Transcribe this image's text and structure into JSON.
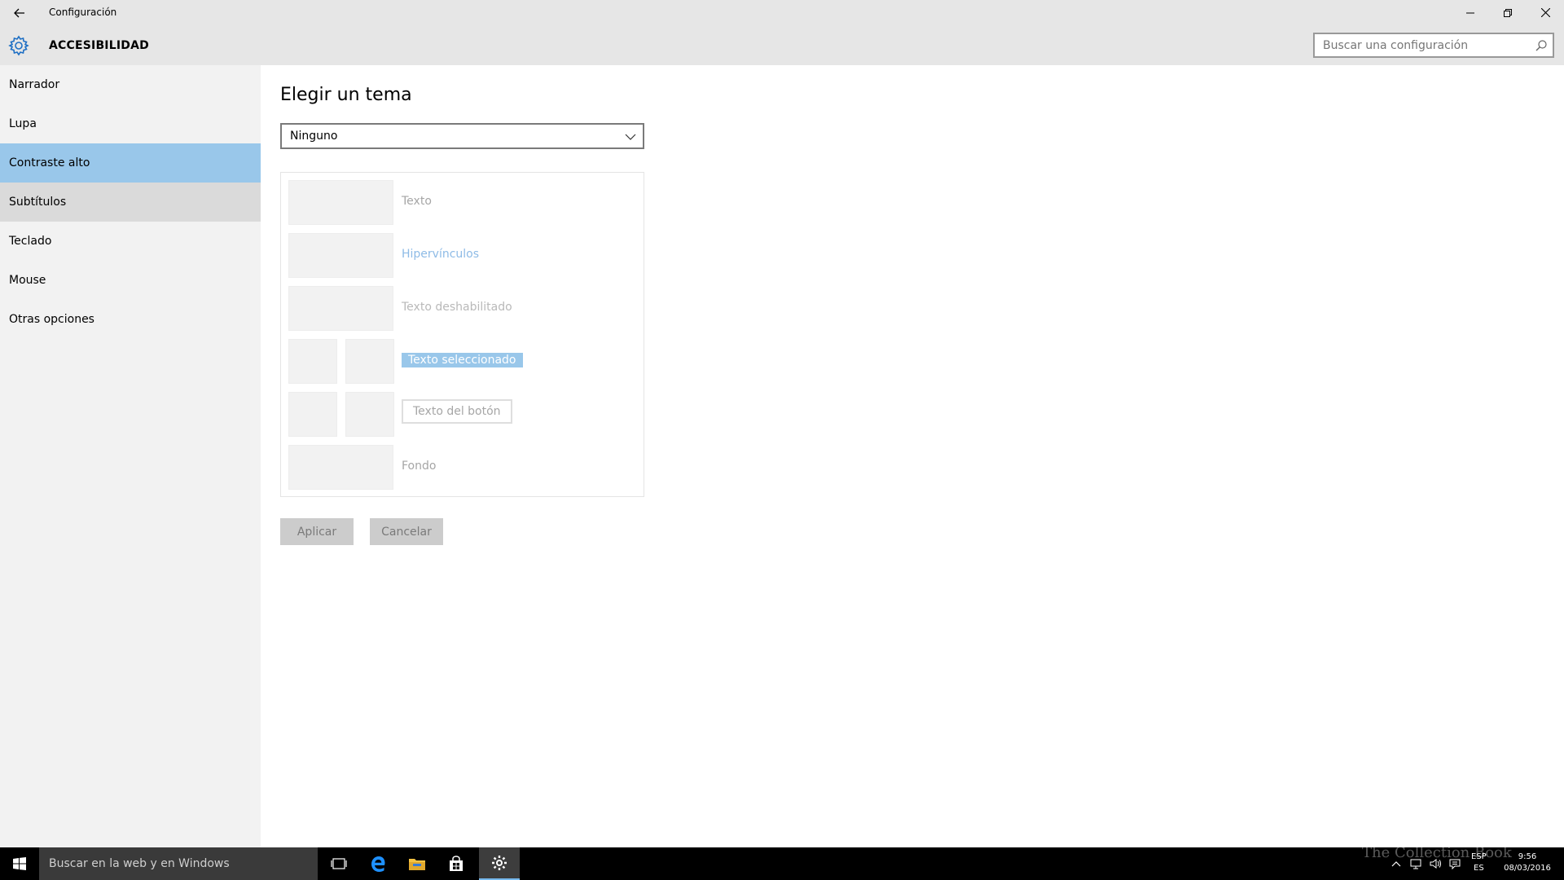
{
  "window": {
    "title": "Configuración"
  },
  "header": {
    "section_title": "ACCESIBILIDAD",
    "search_placeholder": "Buscar una configuración"
  },
  "sidebar": {
    "items": [
      {
        "label": "Narrador"
      },
      {
        "label": "Lupa"
      },
      {
        "label": "Contraste alto",
        "selected": true
      },
      {
        "label": "Subtítulos"
      },
      {
        "label": "Teclado"
      },
      {
        "label": "Mouse"
      },
      {
        "label": "Otras opciones"
      }
    ]
  },
  "main": {
    "heading": "Elegir un tema",
    "theme_select_value": "Ninguno",
    "preview": {
      "text_label": "Texto",
      "hyperlink_label": "Hipervínculos",
      "disabled_label": "Texto deshabilitado",
      "selected_label": "Texto seleccionado",
      "button_label": "Texto del botón",
      "background_label": "Fondo"
    },
    "apply_label": "Aplicar",
    "cancel_label": "Cancelar"
  },
  "taskbar": {
    "search_placeholder": "Buscar en la web y en Windows",
    "language_top": "ESP",
    "language_bottom": "ES",
    "time": "9:56",
    "date": "08/03/2016"
  },
  "watermark": "The Collection Book",
  "colors": {
    "selected_nav": "#99c7ea",
    "hover_nav": "#dadada",
    "sidebar_bg": "#f2f2f2",
    "titlebar_bg": "#e6e6e6",
    "taskbar_bg": "#000000",
    "accent": "#76b9ed"
  }
}
